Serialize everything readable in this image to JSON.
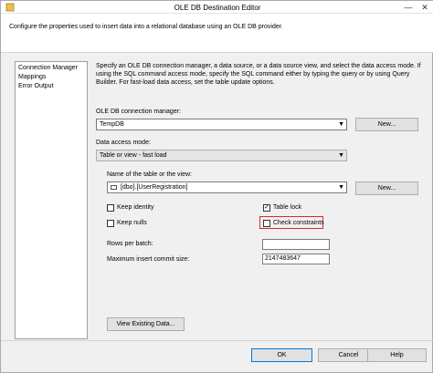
{
  "window": {
    "title": "OLE DB Destination Editor",
    "minimize_icon": "minimize-icon",
    "close_icon": "close-icon"
  },
  "header": {
    "text": "Configure the properties used to insert data into a relational database using an OLE DB provider."
  },
  "nav": {
    "items": [
      "Connection Manager",
      "Mappings",
      "Error Output"
    ]
  },
  "main": {
    "description": "Specify an OLE DB connection manager, a data source, or a data source view, and select the data access mode. If using the SQL command access mode, specify the SQL command either by typing the query or by using Query Builder. For fast-load data access, set the table update options.",
    "conn_label": "OLE DB connection manager:",
    "conn_value": "TempDB",
    "new_button_1": "New...",
    "access_label": "Data access mode:",
    "access_value": "Table or view - fast load",
    "table_label": "Name of the table or the view:",
    "table_value": "[dbo].[UserRegistration]",
    "new_button_2": "New...",
    "keep_identity": "Keep identity",
    "keep_nulls": "Keep nulls",
    "table_lock": "Table lock",
    "check_constraints": "Check constraints",
    "rows_label": "Rows per batch:",
    "rows_value": "",
    "max_commit_label": "Maximum insert commit size:",
    "max_commit_value": "2147483647",
    "view_button": "View Existing Data..."
  },
  "footer": {
    "ok": "OK",
    "cancel": "Cancel",
    "help": "Help"
  },
  "checks": {
    "keep_identity": false,
    "keep_nulls": false,
    "table_lock": true,
    "check_constraints": false
  }
}
